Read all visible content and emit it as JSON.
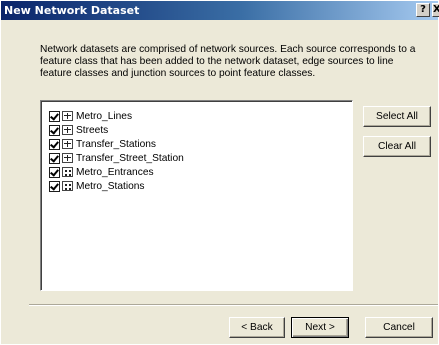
{
  "window": {
    "title": "New Network Dataset",
    "help_button": "?",
    "close_button": "X"
  },
  "description": "Network datasets are comprised of network sources.  Each source corresponds to a feature class that has been added to the network dataset, edge sources to line feature classes and junction sources to point feature classes.",
  "sources": [
    {
      "label": "Metro_Lines",
      "checked": true,
      "icon": "line-feature-class-icon"
    },
    {
      "label": "Streets",
      "checked": true,
      "icon": "line-feature-class-icon"
    },
    {
      "label": "Transfer_Stations",
      "checked": true,
      "icon": "line-feature-class-icon"
    },
    {
      "label": "Transfer_Street_Station",
      "checked": true,
      "icon": "line-feature-class-icon"
    },
    {
      "label": "Metro_Entrances",
      "checked": true,
      "icon": "point-feature-class-icon"
    },
    {
      "label": "Metro_Stations",
      "checked": true,
      "icon": "point-feature-class-icon"
    }
  ],
  "side_buttons": {
    "select_all": "Select All",
    "clear_all": "Clear All"
  },
  "footer": {
    "back": "< Back",
    "next": "Next >",
    "cancel": "Cancel"
  },
  "colors": {
    "dialog_bg": "#ece9d8",
    "titlebar_start": "#0a246a",
    "titlebar_end": "#a6caf0"
  }
}
